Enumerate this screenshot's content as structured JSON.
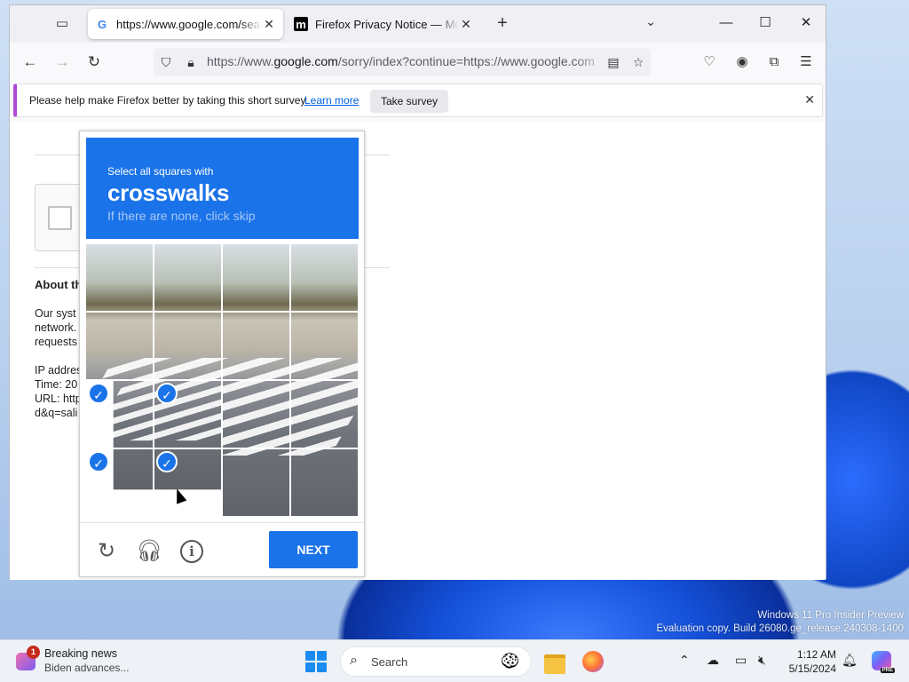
{
  "desktop": {
    "watermark_line1": "Windows 11 Pro Insider Preview",
    "watermark_line2": "Evaluation copy. Build 26080.ge_release.240308-1400"
  },
  "browser": {
    "tabs": [
      {
        "title": "https://www.google.com/search",
        "favicon": "google-g-icon",
        "active": true
      },
      {
        "title": "Firefox Privacy Notice — Mozilla",
        "favicon": "mozilla-m-icon",
        "active": false
      }
    ],
    "url": {
      "prefix": "https://www.",
      "domain": "google.com",
      "rest": "/sorry/index?continue=https://www.google.com"
    },
    "survey": {
      "message": "Please help make Firefox better by taking this short survey",
      "learn_more": "Learn more",
      "take_survey": "Take survey"
    }
  },
  "page": {
    "about_title": "About th",
    "about_text": "Our syst\nnetwork.\nrequests\n\nIP addres\nTime: 20\nURL: http\nd&q=sali"
  },
  "captcha": {
    "instruction": "Select all squares with",
    "target": "crosswalks",
    "hint": "If there are none, click skip",
    "next_label": "NEXT",
    "selected_cells": [
      8,
      9,
      12,
      13
    ]
  },
  "taskbar": {
    "news_title": "Breaking news",
    "news_subtitle": "Biden advances...",
    "news_badge": "1",
    "search_label": "Search",
    "time": "1:12 AM",
    "date": "5/15/2024",
    "copilot_badge": "PRE"
  }
}
